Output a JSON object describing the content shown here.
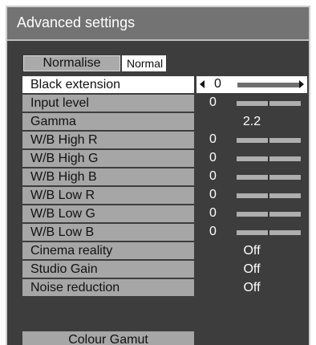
{
  "title": "Advanced settings",
  "normalise": {
    "label": "Normalise",
    "status": "Normal"
  },
  "rows": [
    {
      "label": "Black extension",
      "value": "0",
      "level": 0.0,
      "selected": true
    },
    {
      "label": "Input level",
      "value": "0",
      "level": 0.5
    },
    {
      "label": "Gamma",
      "value": "2.2"
    },
    {
      "label": "W/B High R",
      "value": "0",
      "level": 0.5
    },
    {
      "label": "W/B High G",
      "value": "0",
      "level": 0.5
    },
    {
      "label": "W/B High B",
      "value": "0",
      "level": 0.5
    },
    {
      "label": "W/B Low R",
      "value": "0",
      "level": 0.5
    },
    {
      "label": "W/B Low G",
      "value": "0",
      "level": 0.5
    },
    {
      "label": "W/B Low B",
      "value": "0",
      "level": 0.5
    },
    {
      "label": "Cinema reality",
      "value": "Off"
    },
    {
      "label": "Studio Gain",
      "value": "Off"
    },
    {
      "label": "Noise reduction",
      "value": "Off"
    }
  ],
  "colour_gamut_label": "Colour Gamut",
  "icons": {
    "left": "left-arrow-icon",
    "right": "right-arrow-icon"
  },
  "colors": {
    "menu_bg": "#3d3d3d",
    "title_bg": "#737373",
    "label_bg": "#a6a6a6",
    "selected_bg": "#ffffff"
  }
}
